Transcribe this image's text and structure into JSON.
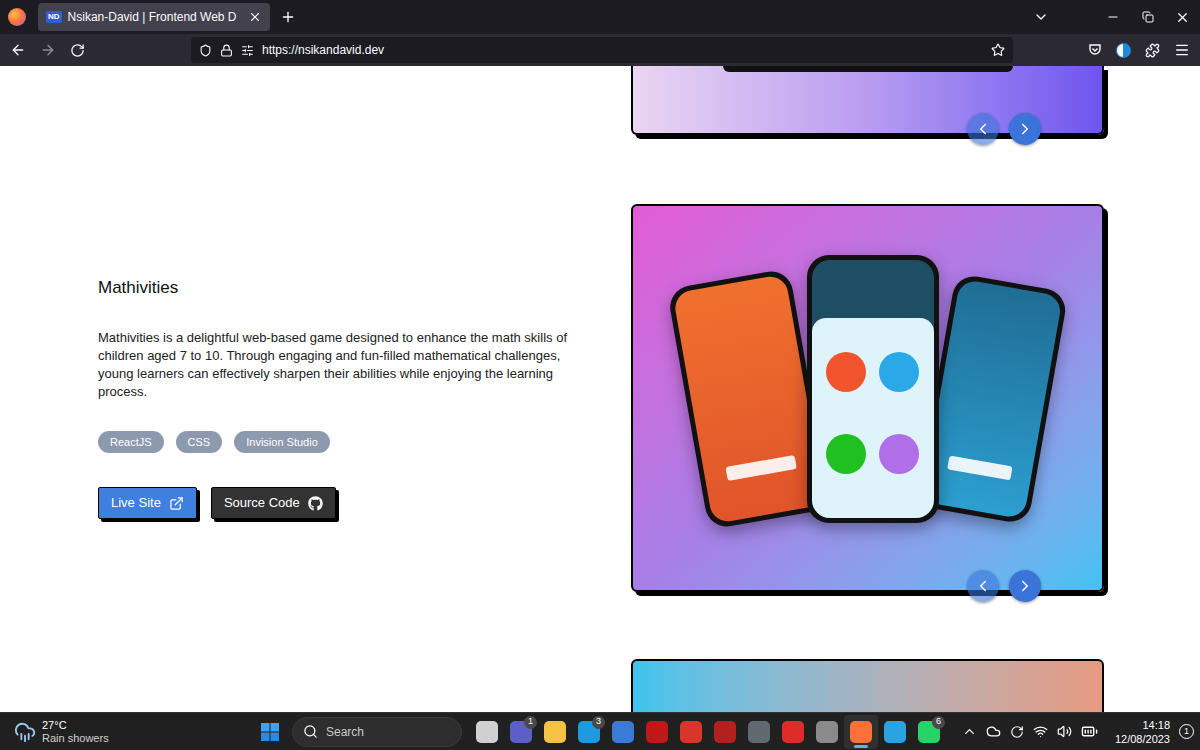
{
  "browser": {
    "tabs": [
      {
        "favicon": "ND",
        "label": "Nsikan-David | Frontend Web D",
        "selected": true
      }
    ],
    "url": "https://nsikandavid.dev"
  },
  "carousels": [
    {
      "prev_disabled": true
    },
    {
      "prev_disabled": true
    }
  ],
  "project": {
    "title": "Mathivities",
    "description": "Mathivities is a delightful web-based game designed to enhance the math skills of children aged 7 to 10. Through engaging and fun-filled mathematical challenges, young learners can effectively sharpen their abilities while enjoying the learning process.",
    "tags": [
      "ReactJS",
      "CSS",
      "Invision Studio"
    ],
    "buttons": [
      {
        "label": "Live Site",
        "kind": "live"
      },
      {
        "label": "Source Code",
        "kind": "source"
      }
    ]
  },
  "taskbar": {
    "weather": {
      "temperature": "27°C",
      "condition": "Rain showers"
    },
    "search": {
      "placeholder": "Search"
    },
    "apps": [
      {
        "color": "#d0d0d0",
        "badge": null,
        "selected": false
      },
      {
        "color": "#5b5fc7",
        "badge": "1",
        "selected": false
      },
      {
        "color": "#f5c243",
        "badge": null,
        "selected": false
      },
      {
        "color": "#1e9be0",
        "badge": "3",
        "selected": false
      },
      {
        "color": "#3a7bd5",
        "badge": null,
        "selected": false
      },
      {
        "color": "#c01818",
        "badge": null,
        "selected": false
      },
      {
        "color": "#d9362b",
        "badge": null,
        "selected": false
      },
      {
        "color": "#b32020",
        "badge": null,
        "selected": false
      },
      {
        "color": "#606870",
        "badge": null,
        "selected": false
      },
      {
        "color": "#e02b2b",
        "badge": null,
        "selected": false
      },
      {
        "color": "#8a8a8a",
        "badge": null,
        "selected": false
      },
      {
        "color": "#ff7139",
        "badge": null,
        "selected": true
      },
      {
        "color": "#2aa4e0",
        "badge": null,
        "selected": false
      },
      {
        "color": "#25d366",
        "badge": "6",
        "selected": false
      }
    ],
    "clock": {
      "time": "14:18",
      "date": "12/08/2023"
    },
    "notifications": "1"
  }
}
